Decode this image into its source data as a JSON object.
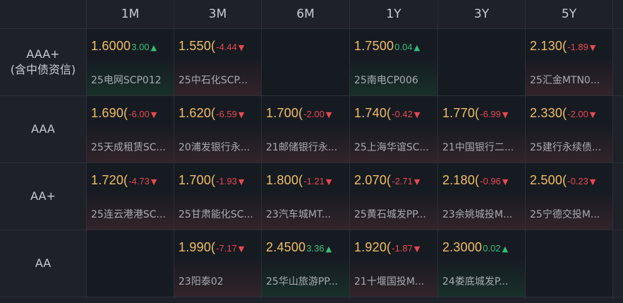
{
  "columns": [
    "1M",
    "3M",
    "6M",
    "1Y",
    "3Y",
    "5Y"
  ],
  "rows": [
    {
      "label_line1": "AAA+",
      "label_line2": "(含中债资信)",
      "cells": [
        {
          "yield": "1.6000",
          "change": "3.00",
          "dir": "up",
          "bond": "25电网SCP012"
        },
        {
          "yield": "1.550(",
          "change": "-4.44",
          "dir": "down",
          "bond": "25中石化SCP..."
        },
        null,
        {
          "yield": "1.7500",
          "change": "0.04",
          "dir": "up",
          "bond": "25南电CP006"
        },
        null,
        {
          "yield": "2.130(",
          "change": "-1.89",
          "dir": "down",
          "bond": "25汇金MTN0..."
        }
      ]
    },
    {
      "label_line1": "AAA",
      "label_line2": "",
      "cells": [
        {
          "yield": "1.690(",
          "change": "-6.00",
          "dir": "down",
          "bond": "25天成租赁SC..."
        },
        {
          "yield": "1.620(",
          "change": "-6.59",
          "dir": "down",
          "bond": "20浦发银行永..."
        },
        {
          "yield": "1.700(",
          "change": "-2.00",
          "dir": "down",
          "bond": "21邮储银行永..."
        },
        {
          "yield": "1.740(",
          "change": "-0.42",
          "dir": "down",
          "bond": "25上海华谊SC..."
        },
        {
          "yield": "1.770(",
          "change": "-6.99",
          "dir": "down",
          "bond": "21中国银行二..."
        },
        {
          "yield": "2.330(",
          "change": "-2.00",
          "dir": "down",
          "bond": "25建行永续债..."
        }
      ]
    },
    {
      "label_line1": "AA+",
      "label_line2": "",
      "cells": [
        {
          "yield": "1.720(",
          "change": "-4.73",
          "dir": "down",
          "bond": "25连云港港SC..."
        },
        {
          "yield": "1.700(",
          "change": "-1.93",
          "dir": "down",
          "bond": "25甘肃能化SC..."
        },
        {
          "yield": "1.800(",
          "change": "-1.21",
          "dir": "down",
          "bond": "23汽车城MT..."
        },
        {
          "yield": "2.070(",
          "change": "-2.71",
          "dir": "down",
          "bond": "25黄石城发PP..."
        },
        {
          "yield": "2.180(",
          "change": "-0.96",
          "dir": "down",
          "bond": "23余姚城投M..."
        },
        {
          "yield": "2.500(",
          "change": "-0.23",
          "dir": "down",
          "bond": "25宁德交投M..."
        }
      ]
    },
    {
      "label_line1": "AA",
      "label_line2": "",
      "cells": [
        null,
        {
          "yield": "1.990(",
          "change": "-7.17",
          "dir": "down",
          "bond": "23阳泰02"
        },
        {
          "yield": "2.4500",
          "change": "3.36",
          "dir": "up",
          "bond": "25华山旅游PP..."
        },
        {
          "yield": "1.920(",
          "change": "-1.87",
          "dir": "down",
          "bond": "21十堰国投M..."
        },
        {
          "yield": "2.3000",
          "change": "0.02",
          "dir": "up",
          "bond": "24娄底城发P..."
        },
        null
      ]
    }
  ],
  "icons": {
    "up": "triangle-up-icon",
    "down": "triangle-down-icon"
  },
  "colors": {
    "yield": "#f2c063",
    "up": "#2ec27a",
    "down": "#e8484f"
  }
}
